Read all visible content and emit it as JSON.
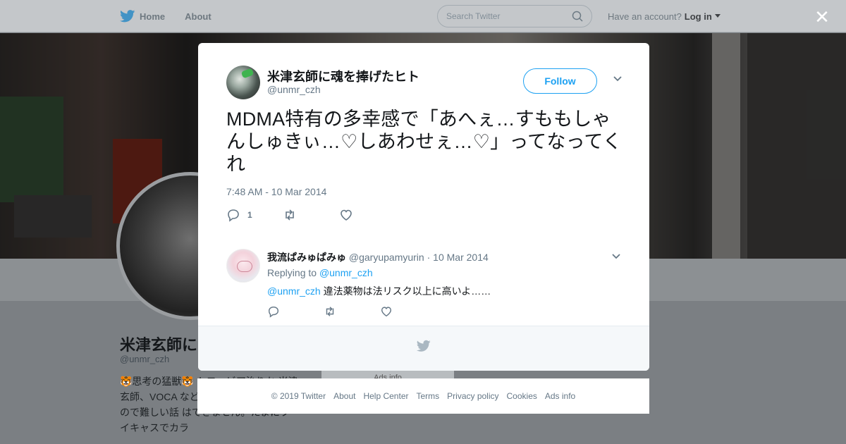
{
  "nav": {
    "home_label": "Home",
    "about_label": "About",
    "search_placeholder": "Search Twitter",
    "account_prompt": "Have an account?",
    "login_label": "Log in"
  },
  "profile_bg": {
    "name": "米津玄師に魂",
    "handle": "@unmr_czh",
    "bio": "🐯思考の猛獣🐯 トフォビア治りか 米津玄師、VOCA などが好きです。頭が悪いので難しい話 はできません。たまにツイキャスでカラ",
    "ads_label": "Ads info"
  },
  "tweet": {
    "author_name": "米津玄師に魂を捧げたヒト",
    "author_handle": "@unmr_czh",
    "follow_label": "Follow",
    "text": "MDMA特有の多幸感で「あへぇ…すももしゃんしゅきぃ…♡しあわせぇ…♡」ってなってくれ",
    "timestamp": "7:48 AM - 10 Mar 2014",
    "reply_count": "1",
    "retweet_count": "",
    "like_count": ""
  },
  "reply": {
    "author_name": "我流ぱみゅぱみゅ",
    "author_handle": "@garyupamyurin",
    "separator": "·",
    "date": "10 Mar 2014",
    "replying_prefix": "Replying to",
    "replying_to": "@unmr_czh",
    "mention": "@unmr_czh",
    "text": "違法薬物は法リスク以上に高いよ……"
  },
  "footer": {
    "links": [
      "© 2019 Twitter",
      "About",
      "Help Center",
      "Terms",
      "Privacy policy",
      "Cookies",
      "Ads info"
    ]
  },
  "colors": {
    "accent": "#1da1f2",
    "text_primary": "#14171a",
    "text_secondary": "#657786"
  }
}
